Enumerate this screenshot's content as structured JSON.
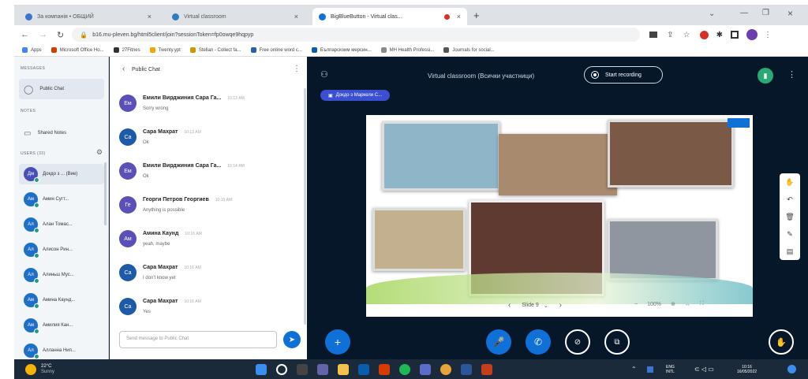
{
  "browser": {
    "tabs": [
      {
        "title": "За компанія • ОБЩИЙ",
        "active": false
      },
      {
        "title": "Virtual classroom",
        "active": false
      },
      {
        "title": "BigBlueButton - Virtual clas...",
        "active": true
      }
    ],
    "new_tab": "+",
    "url": "b16.mu-pleven.bg/html5client/join?sessionToken=fp0owqe9hqpyp",
    "bookmarks": [
      "Apps",
      "Microsoft Office Ho...",
      "27Fitnes",
      "Twenty.ypt",
      "Stellan - Collect fa...",
      "Free online word c...",
      "Бълпарскоим мерсин...",
      "MH Health Professi...",
      "Journals for social..."
    ]
  },
  "sidebar": {
    "messages_heading": "MESSAGES",
    "public_chat": "Public Chat",
    "notes_heading": "NOTES",
    "shared_notes": "Shared Notes",
    "users_heading": "USERS (33)",
    "users": [
      {
        "initials": "Дм",
        "name": "Докдо з ... (Вие)",
        "color": "#4a4fb5"
      },
      {
        "initials": "Ам",
        "name": "Амин Сугт...",
        "color": "#1e6fc6"
      },
      {
        "initials": "Ал",
        "name": "Алан Томас...",
        "color": "#1e6fc6"
      },
      {
        "initials": "Ал",
        "name": "Алисон Рин...",
        "color": "#1e6fc6"
      },
      {
        "initials": "Ал",
        "name": "Алиньш Мус...",
        "color": "#1e6fc6"
      },
      {
        "initials": "Ам",
        "name": "Амина Каунд...",
        "color": "#1e6fc6"
      },
      {
        "initials": "Ам",
        "name": "Амилия Кан...",
        "color": "#1e6fc6"
      },
      {
        "initials": "Ал",
        "name": "Алланна Нип...",
        "color": "#1e6fc6"
      }
    ]
  },
  "chat": {
    "title": "Public Chat",
    "back": "‹",
    "menu": "⋮",
    "messages": [
      {
        "initials": "Ем",
        "name": "Емили Вирджиния Сара Га...",
        "time": "10:13 AM",
        "text": "Sorry wrong",
        "color": "#5b4fb8"
      },
      {
        "initials": "Са",
        "name": "Сара Махрат",
        "time": "10:13 AM",
        "text": "Ok",
        "color": "#1e5aa8"
      },
      {
        "initials": "Ем",
        "name": "Емили Вирджиния Сара Га...",
        "time": "10:14 AM",
        "text": "Ok",
        "color": "#5b4fb8"
      },
      {
        "initials": "Ге",
        "name": "Георги Петров Георгиев",
        "time": "10:15 AM",
        "text": "Anything is possible",
        "color": "#5b4fb8"
      },
      {
        "initials": "Ам",
        "name": "Амина Каунд",
        "time": "10:16 AM",
        "text": "yeah, maybe",
        "color": "#5b4fb8"
      },
      {
        "initials": "Са",
        "name": "Сара Махрат",
        "time": "10:16 AM",
        "text": "I don't know yet",
        "color": "#1e5aa8"
      },
      {
        "initials": "Са",
        "name": "Сара Махрат",
        "time": "10:16 AM",
        "text": "Yes",
        "color": "#1e5aa8"
      }
    ],
    "input_placeholder": "Send message to Public Chat"
  },
  "main": {
    "room_title": "Virtual classroom (Всички участници)",
    "record_label": "Start recording",
    "presenter_chip": "Докдо з Маркели С...",
    "slide_label": "Slide 9",
    "zoom_label": "100%",
    "colors": {
      "accent": "#0f70d7",
      "bg": "#06172a",
      "green": "#2aa876"
    }
  },
  "taskbar": {
    "weather_temp": "22°C",
    "weather_desc": "Sunny",
    "lang_top": "ENG",
    "lang_bottom": "INTL",
    "time": "10:16",
    "date": "16/05/2022"
  }
}
